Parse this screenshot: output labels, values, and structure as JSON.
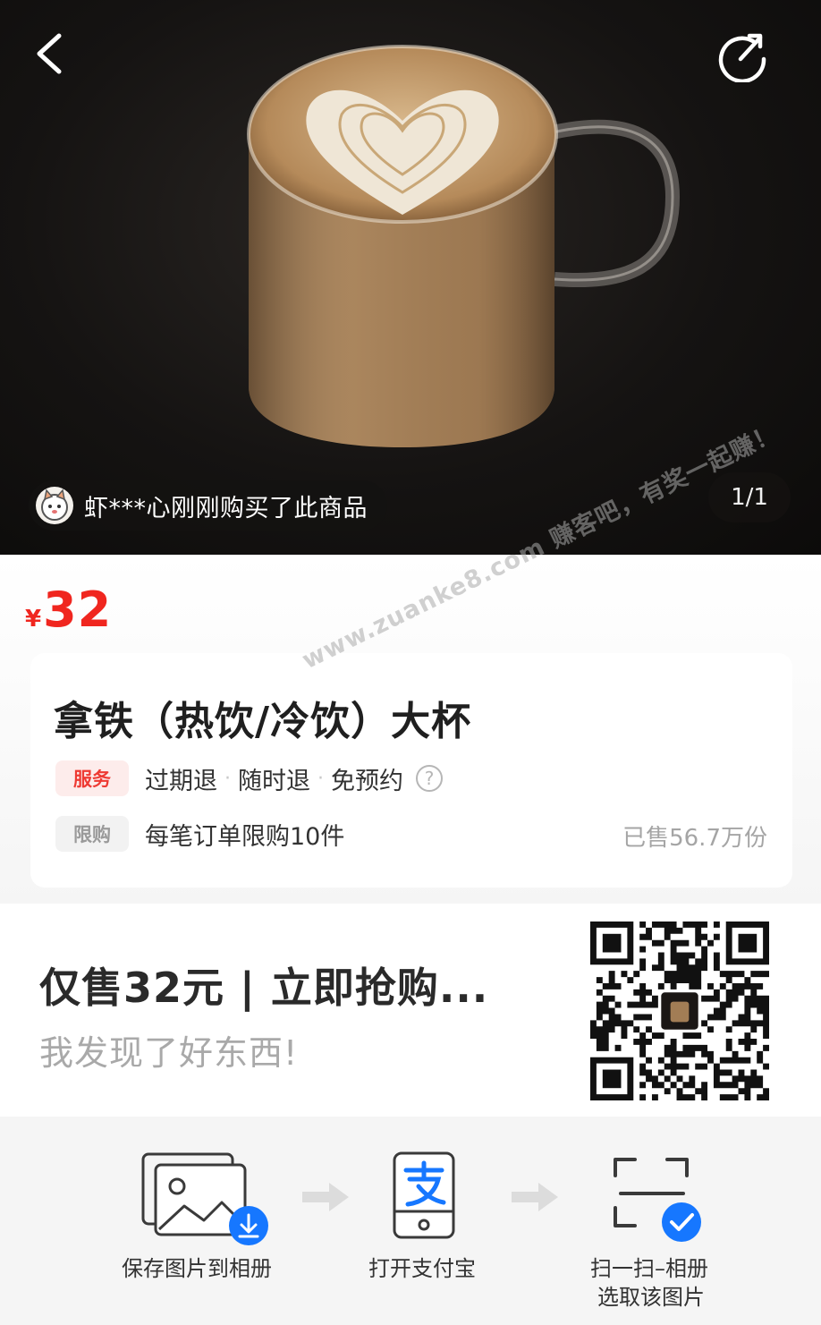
{
  "header": {
    "back_icon": "chevron-left-icon",
    "share_icon": "share-icon"
  },
  "hero": {
    "buyer_notice": "虾***心刚刚购买了此商品",
    "page_counter": "1/1"
  },
  "price": {
    "currency": "¥",
    "value": "32",
    "color": "#f0261f"
  },
  "product": {
    "title": "拿铁（热饮/冷饮）大杯",
    "service_tag": "服务",
    "services": [
      "过期退",
      "随时退",
      "免预约"
    ],
    "help_glyph": "?",
    "limit_tag": "限购",
    "limit_text": "每笔订单限购10件",
    "sold_text": "已售56.7万份"
  },
  "watermark": "www.zuanke8.com 赚客吧，有奖一起赚！",
  "promo": {
    "title": "仅售32元 | 立即抢购...",
    "subtitle": "我发现了好东西!"
  },
  "steps": [
    {
      "label": "保存图片到相册",
      "icon": "save-image-icon"
    },
    {
      "label": "打开支付宝",
      "icon": "alipay-phone-icon"
    },
    {
      "label_line1": "扫一扫–相册",
      "label_line2": "选取该图片",
      "icon": "scan-check-icon"
    }
  ],
  "colors": {
    "accent_blue": "#1677ff",
    "price_red": "#f0261f"
  }
}
